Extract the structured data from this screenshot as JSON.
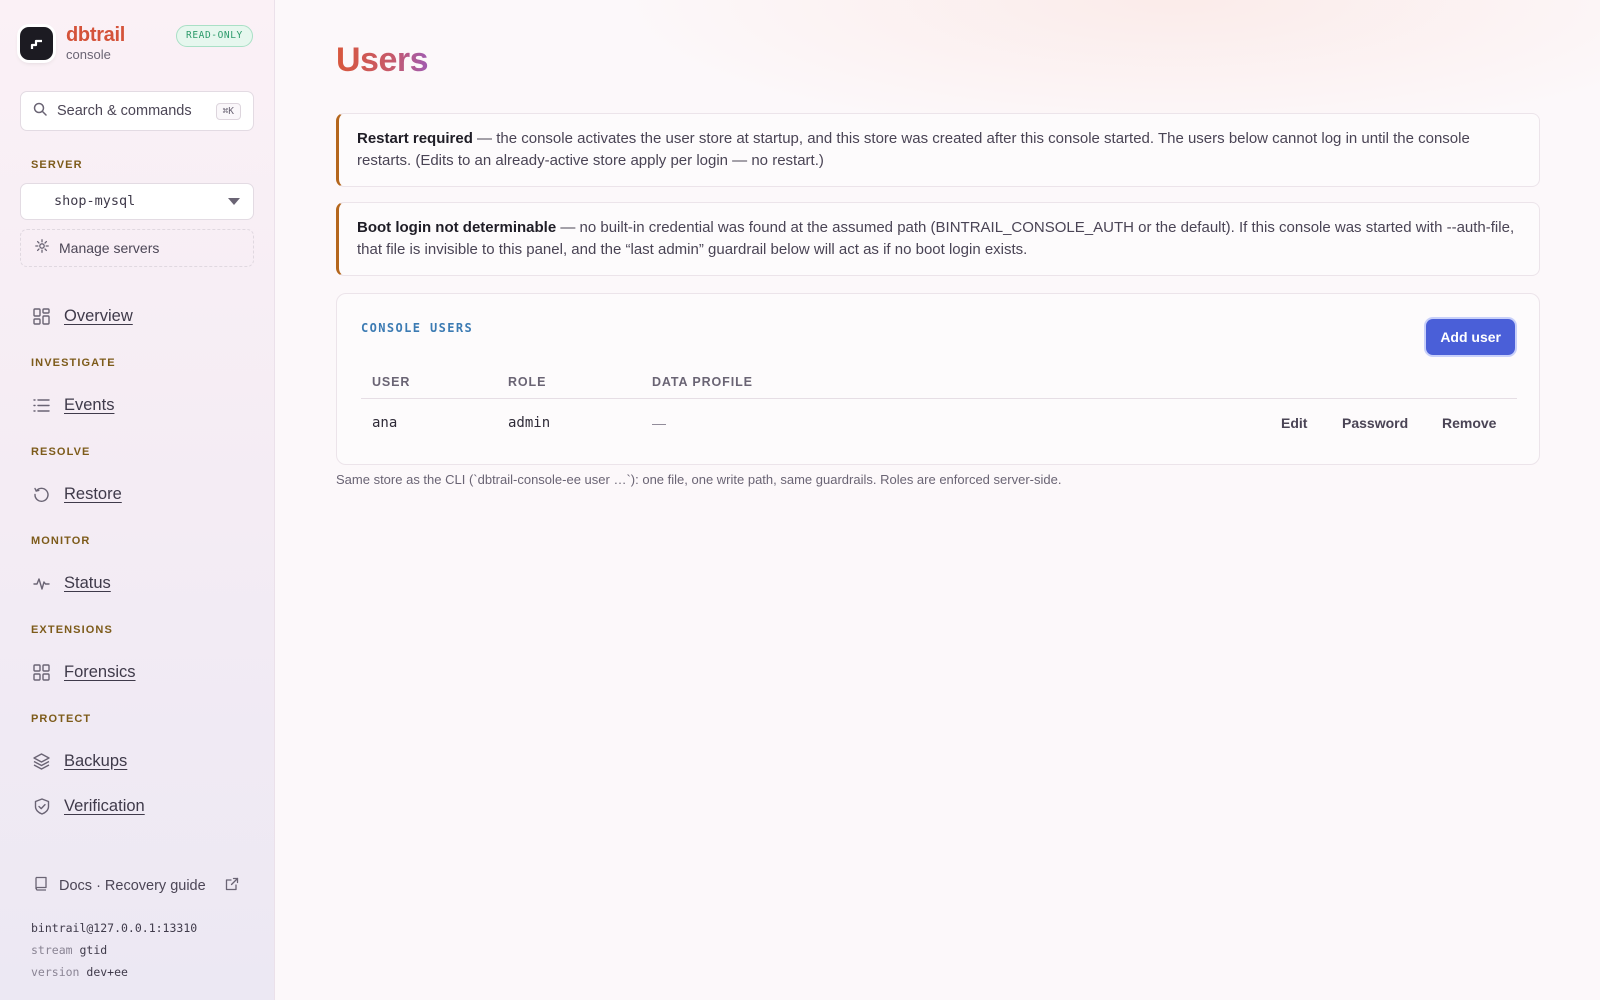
{
  "brand": {
    "name": "dbtrail",
    "sub": "console",
    "badge": "READ-ONLY"
  },
  "search": {
    "label": "Search & commands",
    "shortcut": "⌘K"
  },
  "server": {
    "section_label": "SERVER",
    "selected": "shop-mysql",
    "manage_label": "Manage servers"
  },
  "nav": {
    "overview": "Overview",
    "investigate_label": "INVESTIGATE",
    "events": "Events",
    "resolve_label": "RESOLVE",
    "restore": "Restore",
    "monitor_label": "MONITOR",
    "status": "Status",
    "extensions_label": "EXTENSIONS",
    "forensics": "Forensics",
    "protect_label": "PROTECT",
    "backups": "Backups",
    "verification": "Verification"
  },
  "footer": {
    "docs_label": "Docs · Recovery guide",
    "connection": "bintrail@127.0.0.1:13310",
    "stream_key": "stream",
    "stream_value": "gtid",
    "version_key": "version",
    "version_value": "dev+ee"
  },
  "page": {
    "title": "Users"
  },
  "alerts": [
    {
      "bold": "Restart required",
      "text": " — the console activates the user store at startup, and this store was created after this console started. The users below cannot log in until the console restarts. (Edits to an already-active store apply per login — no restart.)"
    },
    {
      "bold": "Boot login not determinable",
      "text": " — no built-in credential was found at the assumed path (BINTRAIL_CONSOLE_AUTH or the default). If this console was started with --auth-file, that file is invisible to this panel, and the “last admin” guardrail below will act as if no boot login exists."
    }
  ],
  "users_card": {
    "title": "CONSOLE USERS",
    "add_label": "Add user",
    "columns": [
      "USER",
      "ROLE",
      "DATA PROFILE"
    ],
    "rows": [
      {
        "user": "ana",
        "role": "admin",
        "profile": "—",
        "actions": [
          "Edit",
          "Password",
          "Remove"
        ]
      }
    ]
  },
  "footnote": "Same store as the CLI (`dbtrail-console-ee user …`): one file, one write path, same guardrails. Roles are enforced server-side.",
  "colors": {
    "accent": "#4a5fd8",
    "brand": "#d4533a",
    "alert_border": "#b4661c",
    "badge_green": "#2c9a6a"
  }
}
